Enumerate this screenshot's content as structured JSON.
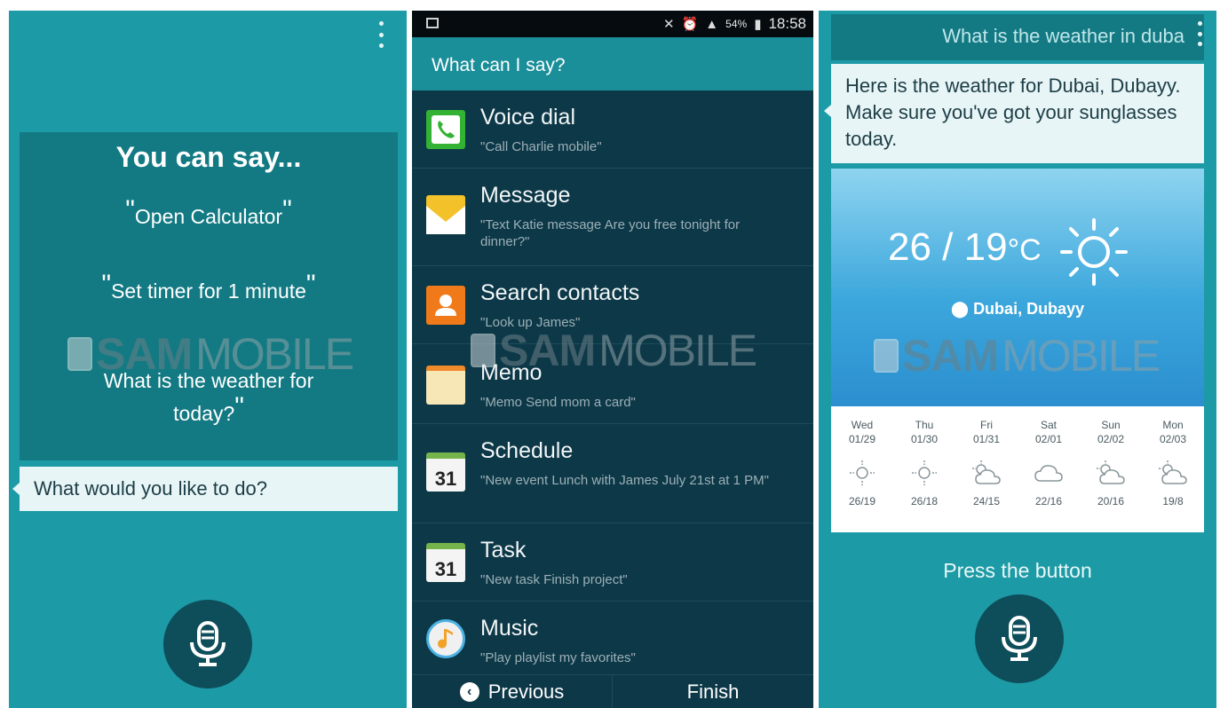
{
  "screen1": {
    "title": "You can say...",
    "examples": [
      "Open Calculator",
      "Set timer for 1 minute",
      "What is the weather for today?"
    ],
    "quote_open": "\"",
    "quote_close": "\"",
    "prompt": "What would you like to do?"
  },
  "screen2": {
    "status": {
      "signal": "54%",
      "time": "18:58"
    },
    "header": "What can I say?",
    "commands": [
      {
        "title": "Voice dial",
        "desc": "\"Call Charlie mobile\"",
        "icon": "phone-icon"
      },
      {
        "title": "Message",
        "desc": "\"Text Katie message Are you free tonight for dinner?\"",
        "icon": "envelope-icon"
      },
      {
        "title": "Search contacts",
        "desc": "\"Look up James\"",
        "icon": "contact-icon"
      },
      {
        "title": "Memo",
        "desc": "\"Memo Send mom a card\"",
        "icon": "memo-icon"
      },
      {
        "title": "Schedule",
        "desc": "\"New event Lunch with James July 21st at 1 PM\"",
        "icon": "calendar-icon",
        "badge": "31"
      },
      {
        "title": "Task",
        "desc": "\"New task Finish project\"",
        "icon": "calendar-icon",
        "badge": "31"
      },
      {
        "title": "Music",
        "desc": "\"Play playlist my favorites\"",
        "icon": "music-icon"
      }
    ],
    "previous_label": "Previous",
    "finish_label": "Finish"
  },
  "screen3": {
    "query": "What is the weather in duba",
    "answer": "Here is the weather for Dubai, Dubayy. Make sure you've got your sunglasses today.",
    "temp": "26 / 19",
    "temp_unit": "°C",
    "location": "Dubai, Dubayy",
    "forecast": [
      {
        "day": "Wed",
        "date": "01/29",
        "temps": "26/19",
        "icon": "sun-icon"
      },
      {
        "day": "Thu",
        "date": "01/30",
        "temps": "26/18",
        "icon": "sun-icon"
      },
      {
        "day": "Fri",
        "date": "01/31",
        "temps": "24/15",
        "icon": "partly-cloudy-icon"
      },
      {
        "day": "Sat",
        "date": "02/01",
        "temps": "22/16",
        "icon": "cloud-icon"
      },
      {
        "day": "Sun",
        "date": "02/02",
        "temps": "20/16",
        "icon": "partly-cloudy-icon"
      },
      {
        "day": "Mon",
        "date": "02/03",
        "temps": "19/8",
        "icon": "partly-cloudy-icon"
      }
    ],
    "press_label": "Press the button"
  },
  "watermark": {
    "brand_bold": "SAM",
    "brand_light": "MOBILE"
  },
  "colors": {
    "teal_bg": "#1c9ba6",
    "panel": "#137a83",
    "list_bg": "#0d3848",
    "mic_button": "#0e4d5a"
  }
}
